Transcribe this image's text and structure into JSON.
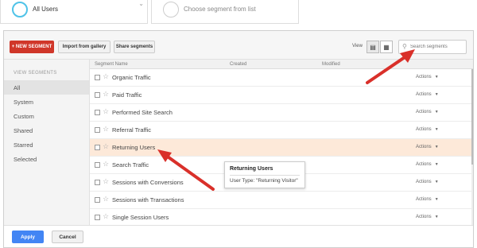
{
  "segments": {
    "active_label": "All Users",
    "placeholder_label": "Choose segment from list"
  },
  "toolbar": {
    "new_segment": "+ NEW SEGMENT",
    "import_gallery": "Import from gallery",
    "share_segments": "Share segments",
    "view_label": "View",
    "search_placeholder": "Search segments"
  },
  "sidebar": {
    "heading": "VIEW SEGMENTS",
    "items": [
      {
        "label": "All"
      },
      {
        "label": "System"
      },
      {
        "label": "Custom"
      },
      {
        "label": "Shared"
      },
      {
        "label": "Starred"
      },
      {
        "label": "Selected"
      }
    ]
  },
  "table": {
    "headers": {
      "name": "Segment Name",
      "created": "Created",
      "modified": "Modified"
    },
    "rows": [
      {
        "name": "Organic Traffic",
        "actions": "Actions"
      },
      {
        "name": "Paid Traffic",
        "actions": "Actions"
      },
      {
        "name": "Performed Site Search",
        "actions": "Actions"
      },
      {
        "name": "Referral Traffic",
        "actions": "Actions"
      },
      {
        "name": "Returning Users",
        "actions": "Actions"
      },
      {
        "name": "Search Traffic",
        "actions": "Actions"
      },
      {
        "name": "Sessions with Conversions",
        "actions": "Actions"
      },
      {
        "name": "Sessions with Transactions",
        "actions": "Actions"
      },
      {
        "name": "Single Session Users",
        "actions": "Actions"
      }
    ]
  },
  "tooltip": {
    "title": "Returning Users",
    "body": "User Type: \"Returning Visitor\""
  },
  "footer": {
    "apply": "Apply",
    "cancel": "Cancel"
  },
  "colors": {
    "new_segment": "#d0372a",
    "apply": "#4285f4",
    "highlight_row": "#fde9d9",
    "arrow": "#d9302a",
    "active_segment_ring": "#4fc3e8"
  }
}
